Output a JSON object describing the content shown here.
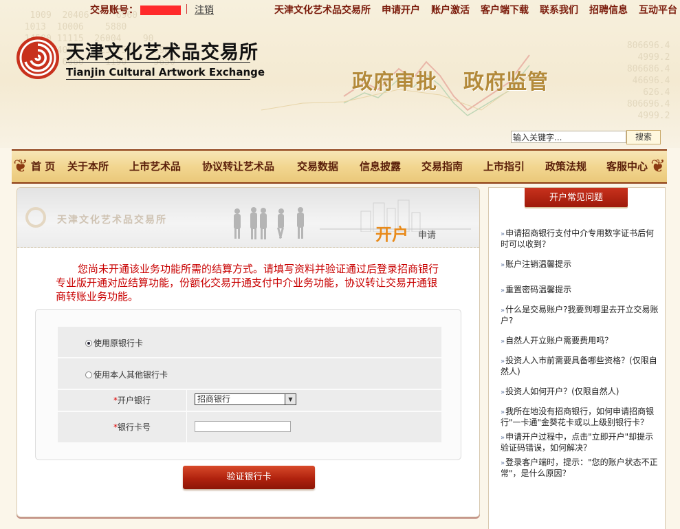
{
  "topbar": {
    "account_label": "交易账号：",
    "logout": "注销",
    "links": [
      "天津文化艺术品交易所",
      "申请开户",
      "账户激活",
      "客户端下载",
      "联系我们",
      "招聘信息",
      "互动平台"
    ]
  },
  "brand": {
    "cn_name": "天津文化艺术品交易所",
    "en_name": "Tianjin Cultural Artwork Exchange",
    "slogan_1": "政府审批",
    "slogan_2": "政府监管"
  },
  "search": {
    "value": "输入关键字...",
    "button": "搜索"
  },
  "nav": [
    "首 页",
    "关于本所",
    "上市艺术品",
    "协议转让艺术品",
    "交易数据",
    "信息披露",
    "交易指南",
    "上市指引",
    "政策法规",
    "客服中心"
  ],
  "panel": {
    "watermark": "天津文化艺术品交易所",
    "title_main": "开户",
    "title_sub": "申请",
    "notice": "您尚未开通该业务功能所需的结算方式。请填写资料并验证通过后登录招商银行专业版开通对应结算功能，份额化交易开通支付中介业务功能，协议转让交易开通银商转账业务功能。",
    "radio_1": "使用原银行卡",
    "radio_2": "使用本人其他银行卡",
    "bank_label": "开户银行",
    "bank_value": "招商银行",
    "card_label": "银行卡号",
    "verify_button": "验证银行卡"
  },
  "faq": {
    "title": "开户常见问题",
    "items": [
      "申请招商银行支付中介专用数字证书后何时可以收到？",
      "账户注销温馨提示",
      "重置密码温馨提示",
      "什么是交易账户?我要到哪里去开立交易账户?",
      "自然人开立账户需要费用吗？",
      "投资人入市前需要具备哪些资格？(仅限自然人)",
      "投资人如何开户？(仅限自然人)",
      "我所在地没有招商银行，如何申请招商银行\"一卡通\"金葵花卡或以上级别银行卡？",
      "申请开户过程中，点击\"立即开户\"却提示验证码错误，如何解决？",
      "登录客户端时，提示：\"您的账户状态不正常\"，是什么原因？"
    ]
  },
  "colors": {
    "brand_red": "#c8311d",
    "nav_gold": "#f2d690",
    "notice_red": "#c80000"
  }
}
